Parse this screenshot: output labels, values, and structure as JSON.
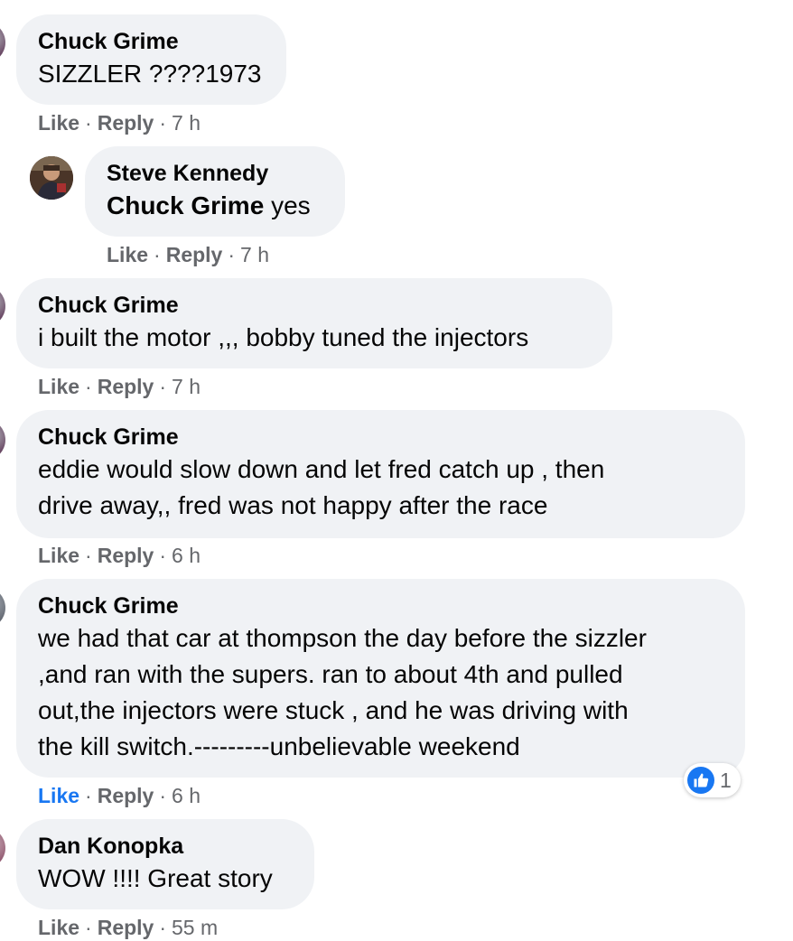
{
  "comments": [
    {
      "author": "Chuck Grime",
      "text": "SIZZLER ????1973",
      "actions": {
        "like": "Like",
        "reply": "Reply",
        "time": "7 h",
        "sep": "·"
      }
    },
    {
      "author": "Steve Kennedy",
      "mention": "Chuck Grime",
      "text": "yes",
      "actions": {
        "like": "Like",
        "reply": "Reply",
        "time": "7 h",
        "sep": "·"
      }
    },
    {
      "author": "Chuck Grime",
      "text": "i built the motor ,,, bobby tuned the injectors",
      "actions": {
        "like": "Like",
        "reply": "Reply",
        "time": "7 h",
        "sep": "·"
      }
    },
    {
      "author": "Chuck Grime",
      "lines": [
        "eddie would slow down and let fred catch up , then",
        "drive away,, fred was not happy after the race"
      ],
      "actions": {
        "like": "Like",
        "reply": "Reply",
        "time": "6 h",
        "sep": "·"
      }
    },
    {
      "author": "Chuck Grime",
      "lines": [
        "we had that car at thompson the day before the sizzler",
        ",and ran with the supers. ran to about 4th and pulled",
        "out,the injectors were stuck , and he was driving with",
        "the kill switch.---------unbelievable weekend"
      ],
      "reaction": {
        "icon": "like-icon",
        "count": "1"
      },
      "actions": {
        "like": "Like",
        "reply": "Reply",
        "time": "6 h",
        "sep": "·"
      }
    },
    {
      "author": "Dan Konopka",
      "text": "WOW !!!! Great story",
      "actions": {
        "like": "Like",
        "reply": "Reply",
        "time": "55 m",
        "sep": "·"
      }
    }
  ],
  "colors": {
    "bubble": "#f0f2f5",
    "meta": "#65676b",
    "liked": "#1877f2",
    "text": "#050505"
  }
}
